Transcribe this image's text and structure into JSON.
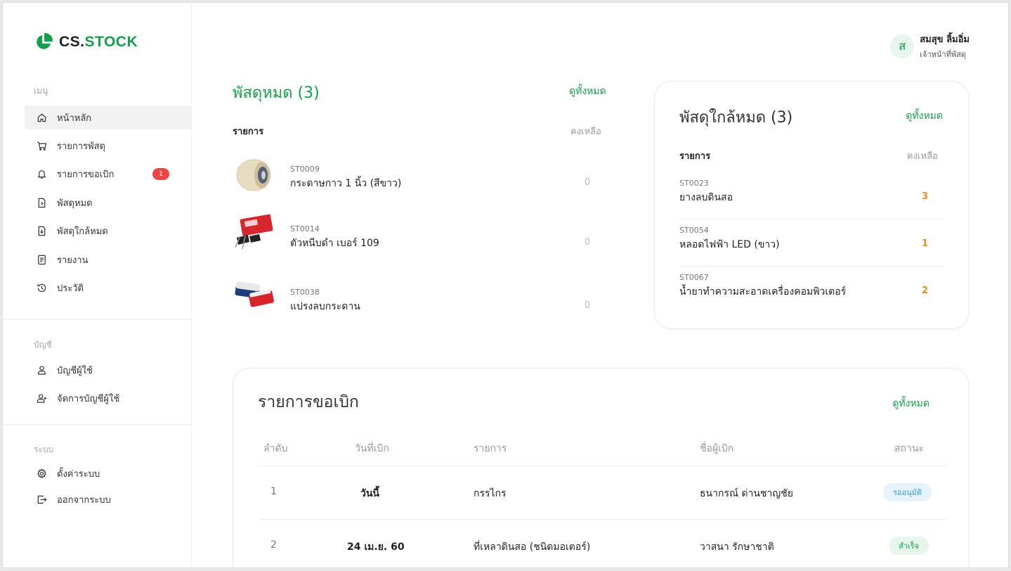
{
  "app": {
    "logo_prefix": "CS.",
    "logo_suffix": "STOCK",
    "brand_color": "#15a04a"
  },
  "sidebar": {
    "menu_title": "เมนู",
    "menu_items": [
      {
        "label": "หน้าหลัก",
        "icon": "home-icon",
        "active": true
      },
      {
        "label": "รายการพัสดุ",
        "icon": "cart-icon"
      },
      {
        "label": "รายการขอเบิก",
        "icon": "bell-icon",
        "badge": "1"
      },
      {
        "label": "พัสดุหมด",
        "icon": "box-out-icon"
      },
      {
        "label": "พัสดุใกล้หมด",
        "icon": "box-low-icon"
      },
      {
        "label": "รายงาน",
        "icon": "report-icon"
      },
      {
        "label": "ประวัติ",
        "icon": "history-icon"
      }
    ],
    "account_title": "บัญชี",
    "account_items": [
      {
        "label": "บัญชีผู้ใช้",
        "icon": "user-icon"
      },
      {
        "label": "จัดการบัญชีผู้ใช้",
        "icon": "user-manage-icon"
      }
    ],
    "system_title": "ระบบ",
    "system_items": [
      {
        "label": "ตั้งค่าระบบ",
        "icon": "gear-icon"
      },
      {
        "label": "ออกจากระบบ",
        "icon": "logout-icon"
      }
    ]
  },
  "user": {
    "initial": "ส",
    "name": "สมสุข ลิ้มอิ่ม",
    "role": "เจ้าหน้าที่พัสดุ"
  },
  "out_of_stock": {
    "title": "พัสดุหมด (3)",
    "view_all": "ดูทั้งหมด",
    "col_item": "รายการ",
    "col_remaining": "คงเหลือ",
    "items": [
      {
        "code": "ST0009",
        "name": "กระดาษกาว 1 นิ้ว (สีขาว)",
        "qty": "0"
      },
      {
        "code": "ST0014",
        "name": "ตัวหนีบดำ เบอร์ 109",
        "qty": "0"
      },
      {
        "code": "ST0038",
        "name": "แปรงลบกระดาน",
        "qty": "0"
      }
    ]
  },
  "low_stock": {
    "title": "พัสดุใกล้หมด (3)",
    "view_all": "ดูทั้งหมด",
    "col_item": "รายการ",
    "col_remaining": "คงเหลือ",
    "items": [
      {
        "code": "ST0023",
        "name": "ยางลบดินสอ",
        "qty": "3"
      },
      {
        "code": "ST0054",
        "name": "หลอดไฟฟ้า LED (ขาว)",
        "qty": "1"
      },
      {
        "code": "ST0067",
        "name": "น้ำยาทำความสะอาดเครื่องคอมพิวเตอร์",
        "qty": "2"
      }
    ]
  },
  "requisitions": {
    "title": "รายการขอเบิก",
    "view_all": "ดูทั้งหมด",
    "columns": [
      "ลำดับ",
      "วันที่เบิก",
      "รายการ",
      "ชื่อผู้เบิก",
      "สถานะ"
    ],
    "rows": [
      {
        "no": "1",
        "date": "วันนี้",
        "item": "กรรไกร",
        "requester": "ธนากรณ์ ด่านชาญชัย",
        "status": "รออนุมัติ",
        "status_type": "pending"
      },
      {
        "no": "2",
        "date": "24 เม.ย. 60",
        "item": "ที่เหลาดินสอ (ชนิดมอเตอร์)",
        "requester": "วาสนา รักษาชาติ",
        "status": "สำเร็จ",
        "status_type": "success"
      }
    ]
  }
}
